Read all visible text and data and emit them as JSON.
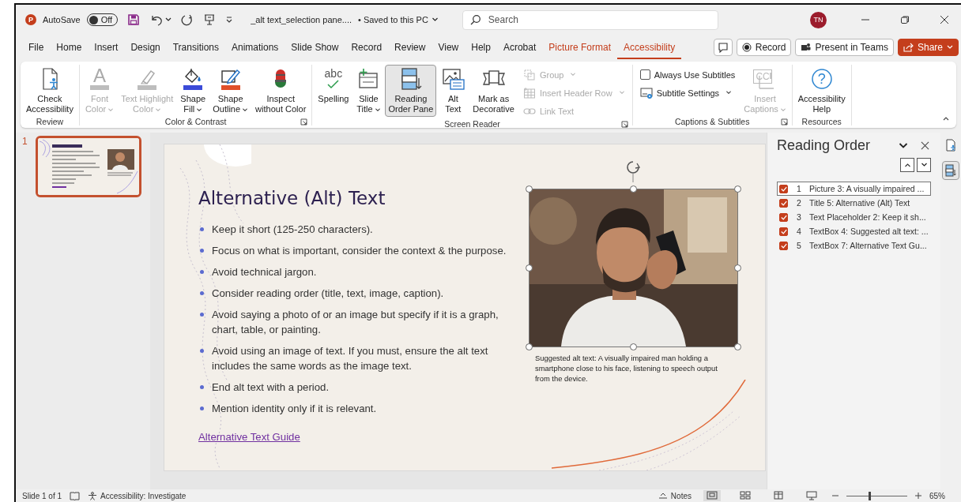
{
  "title_bar": {
    "app_logo_text": "P",
    "autosave_label": "AutoSave",
    "autosave": {
      "label": "Off",
      "on": false
    },
    "document_title": "_alt text_selection pane....",
    "save_status": "• Saved to this PC",
    "search": {
      "placeholder": "Search"
    },
    "account_initials": "TN"
  },
  "tabs": [
    {
      "label": "File",
      "selected": false,
      "kind": "standard"
    },
    {
      "label": "Home",
      "selected": false,
      "kind": "standard"
    },
    {
      "label": "Insert",
      "selected": false,
      "kind": "standard"
    },
    {
      "label": "Design",
      "selected": false,
      "kind": "standard"
    },
    {
      "label": "Transitions",
      "selected": false,
      "kind": "standard"
    },
    {
      "label": "Animations",
      "selected": false,
      "kind": "standard"
    },
    {
      "label": "Slide Show",
      "selected": false,
      "kind": "standard"
    },
    {
      "label": "Record",
      "selected": false,
      "kind": "standard"
    },
    {
      "label": "Review",
      "selected": false,
      "kind": "standard"
    },
    {
      "label": "View",
      "selected": false,
      "kind": "standard"
    },
    {
      "label": "Help",
      "selected": false,
      "kind": "standard"
    },
    {
      "label": "Acrobat",
      "selected": false,
      "kind": "standard"
    },
    {
      "label": "Picture Format",
      "selected": false,
      "kind": "contextual"
    },
    {
      "label": "Accessibility",
      "selected": true,
      "kind": "standard"
    }
  ],
  "header_buttons": [
    {
      "label": "Record",
      "kind": "record"
    },
    {
      "label": "Present in Teams",
      "kind": "teams"
    },
    {
      "label": "Share",
      "kind": "share"
    }
  ],
  "ribbon_groups": [
    {
      "name": "Review",
      "launcher": false,
      "commands": [
        {
          "kind": "large",
          "label": "Check\nAccessibility",
          "disabled": false,
          "dropdown": false,
          "selected": false
        }
      ]
    },
    {
      "name": "Color & Contrast",
      "launcher": true,
      "commands": [
        {
          "kind": "large",
          "label": "Font\nColor",
          "icon_text": "A",
          "disabled": true,
          "dropdown": true,
          "selected": false
        },
        {
          "kind": "large",
          "label": "Text Highlight\nColor",
          "disabled": true,
          "dropdown": true,
          "selected": false
        },
        {
          "kind": "large",
          "label": "Shape\nFill",
          "disabled": false,
          "dropdown": true,
          "selected": false
        },
        {
          "kind": "large",
          "label": "Shape\nOutline",
          "disabled": false,
          "dropdown": true,
          "selected": false
        },
        {
          "kind": "large",
          "label": "Inspect\nwithout Color",
          "disabled": false,
          "dropdown": false,
          "selected": false
        }
      ]
    },
    {
      "name": "Screen Reader",
      "launcher": true,
      "commands": [
        {
          "kind": "large",
          "label": "Spelling",
          "icon_text": "abc",
          "disabled": false,
          "dropdown": false,
          "selected": false
        },
        {
          "kind": "large",
          "label": "Slide\nTitle",
          "disabled": false,
          "dropdown": true,
          "selected": false
        },
        {
          "kind": "large",
          "label": "Reading\nOrder Pane",
          "disabled": false,
          "dropdown": false,
          "selected": true
        },
        {
          "kind": "large",
          "label": "Alt\nText",
          "disabled": false,
          "dropdown": false,
          "selected": false
        },
        {
          "kind": "large",
          "label": "Mark as\nDecorative",
          "disabled": false,
          "dropdown": false,
          "selected": false
        },
        {
          "kind": "small",
          "label": "Group",
          "disabled": true,
          "dropdown": true,
          "selected": false
        },
        {
          "kind": "small",
          "label": "Insert Header Row",
          "disabled": true,
          "dropdown": true,
          "selected": false
        },
        {
          "kind": "small",
          "label": "Link Text",
          "disabled": true,
          "dropdown": false,
          "selected": false
        }
      ]
    },
    {
      "name": "Captions & Subtitles",
      "launcher": true,
      "commands": [
        {
          "kind": "checkbox",
          "label": "Always Use Subtitles",
          "checked": false,
          "disabled": false
        },
        {
          "kind": "small",
          "label": "Subtitle Settings",
          "disabled": false,
          "dropdown": true,
          "selected": false
        },
        {
          "kind": "large",
          "label": "Insert\nCaptions",
          "icon_text": "CC",
          "disabled": true,
          "dropdown": true,
          "selected": false
        }
      ]
    },
    {
      "name": "Resources",
      "launcher": false,
      "commands": [
        {
          "kind": "large",
          "label": "Accessibility\nHelp",
          "icon_text": "?",
          "disabled": false,
          "dropdown": false,
          "selected": false
        }
      ]
    }
  ],
  "thumbnails": [
    {
      "number": "1",
      "selected": true
    }
  ],
  "slide": {
    "title": "Alternative (Alt) Text",
    "bullets": [
      "Keep it short (125-250 characters).",
      "Focus on what is important, consider the context & the purpose.",
      "Avoid technical jargon.",
      "Consider reading order (title, text, image, caption).",
      "Avoid saying a photo of or an image but specify if it is a graph, chart, table, or painting.",
      "Avoid using an image of text. If you must, ensure the alt text includes the same words as the image text.",
      "End alt text with a period.",
      "Mention identity only if it is relevant."
    ],
    "link": "Alternative Text Guide",
    "picture": {
      "kind": "picture",
      "selected": true
    },
    "caption": "Suggested alt text: A visually impaired man holding a smartphone close to his face, listening to speech output from the device."
  },
  "reading_order_pane": {
    "title": "Reading Order",
    "items": [
      {
        "number": "1",
        "label": "Picture 3: A visually impaired ...",
        "checked": true,
        "selected": true
      },
      {
        "number": "2",
        "label": "Title 5: Alternative (Alt) Text",
        "checked": true,
        "selected": false
      },
      {
        "number": "3",
        "label": "Text Placeholder 2: Keep it sh...",
        "checked": true,
        "selected": false
      },
      {
        "number": "4",
        "label": "TextBox 4: Suggested alt text: ...",
        "checked": true,
        "selected": false
      },
      {
        "number": "5",
        "label": "TextBox 7: Alternative Text Gu...",
        "checked": true,
        "selected": false
      }
    ]
  },
  "side_tools": [
    {
      "selected": false
    },
    {
      "selected": true
    }
  ],
  "status_bar": {
    "slide_info": "Slide 1 of 1",
    "accessibility": "Accessibility: Investigate",
    "notes": "Notes",
    "views": [
      {
        "selected": true
      },
      {
        "selected": false
      },
      {
        "selected": false
      },
      {
        "selected": false
      }
    ],
    "zoom": {
      "level": 0.38,
      "reading": "65%"
    }
  }
}
